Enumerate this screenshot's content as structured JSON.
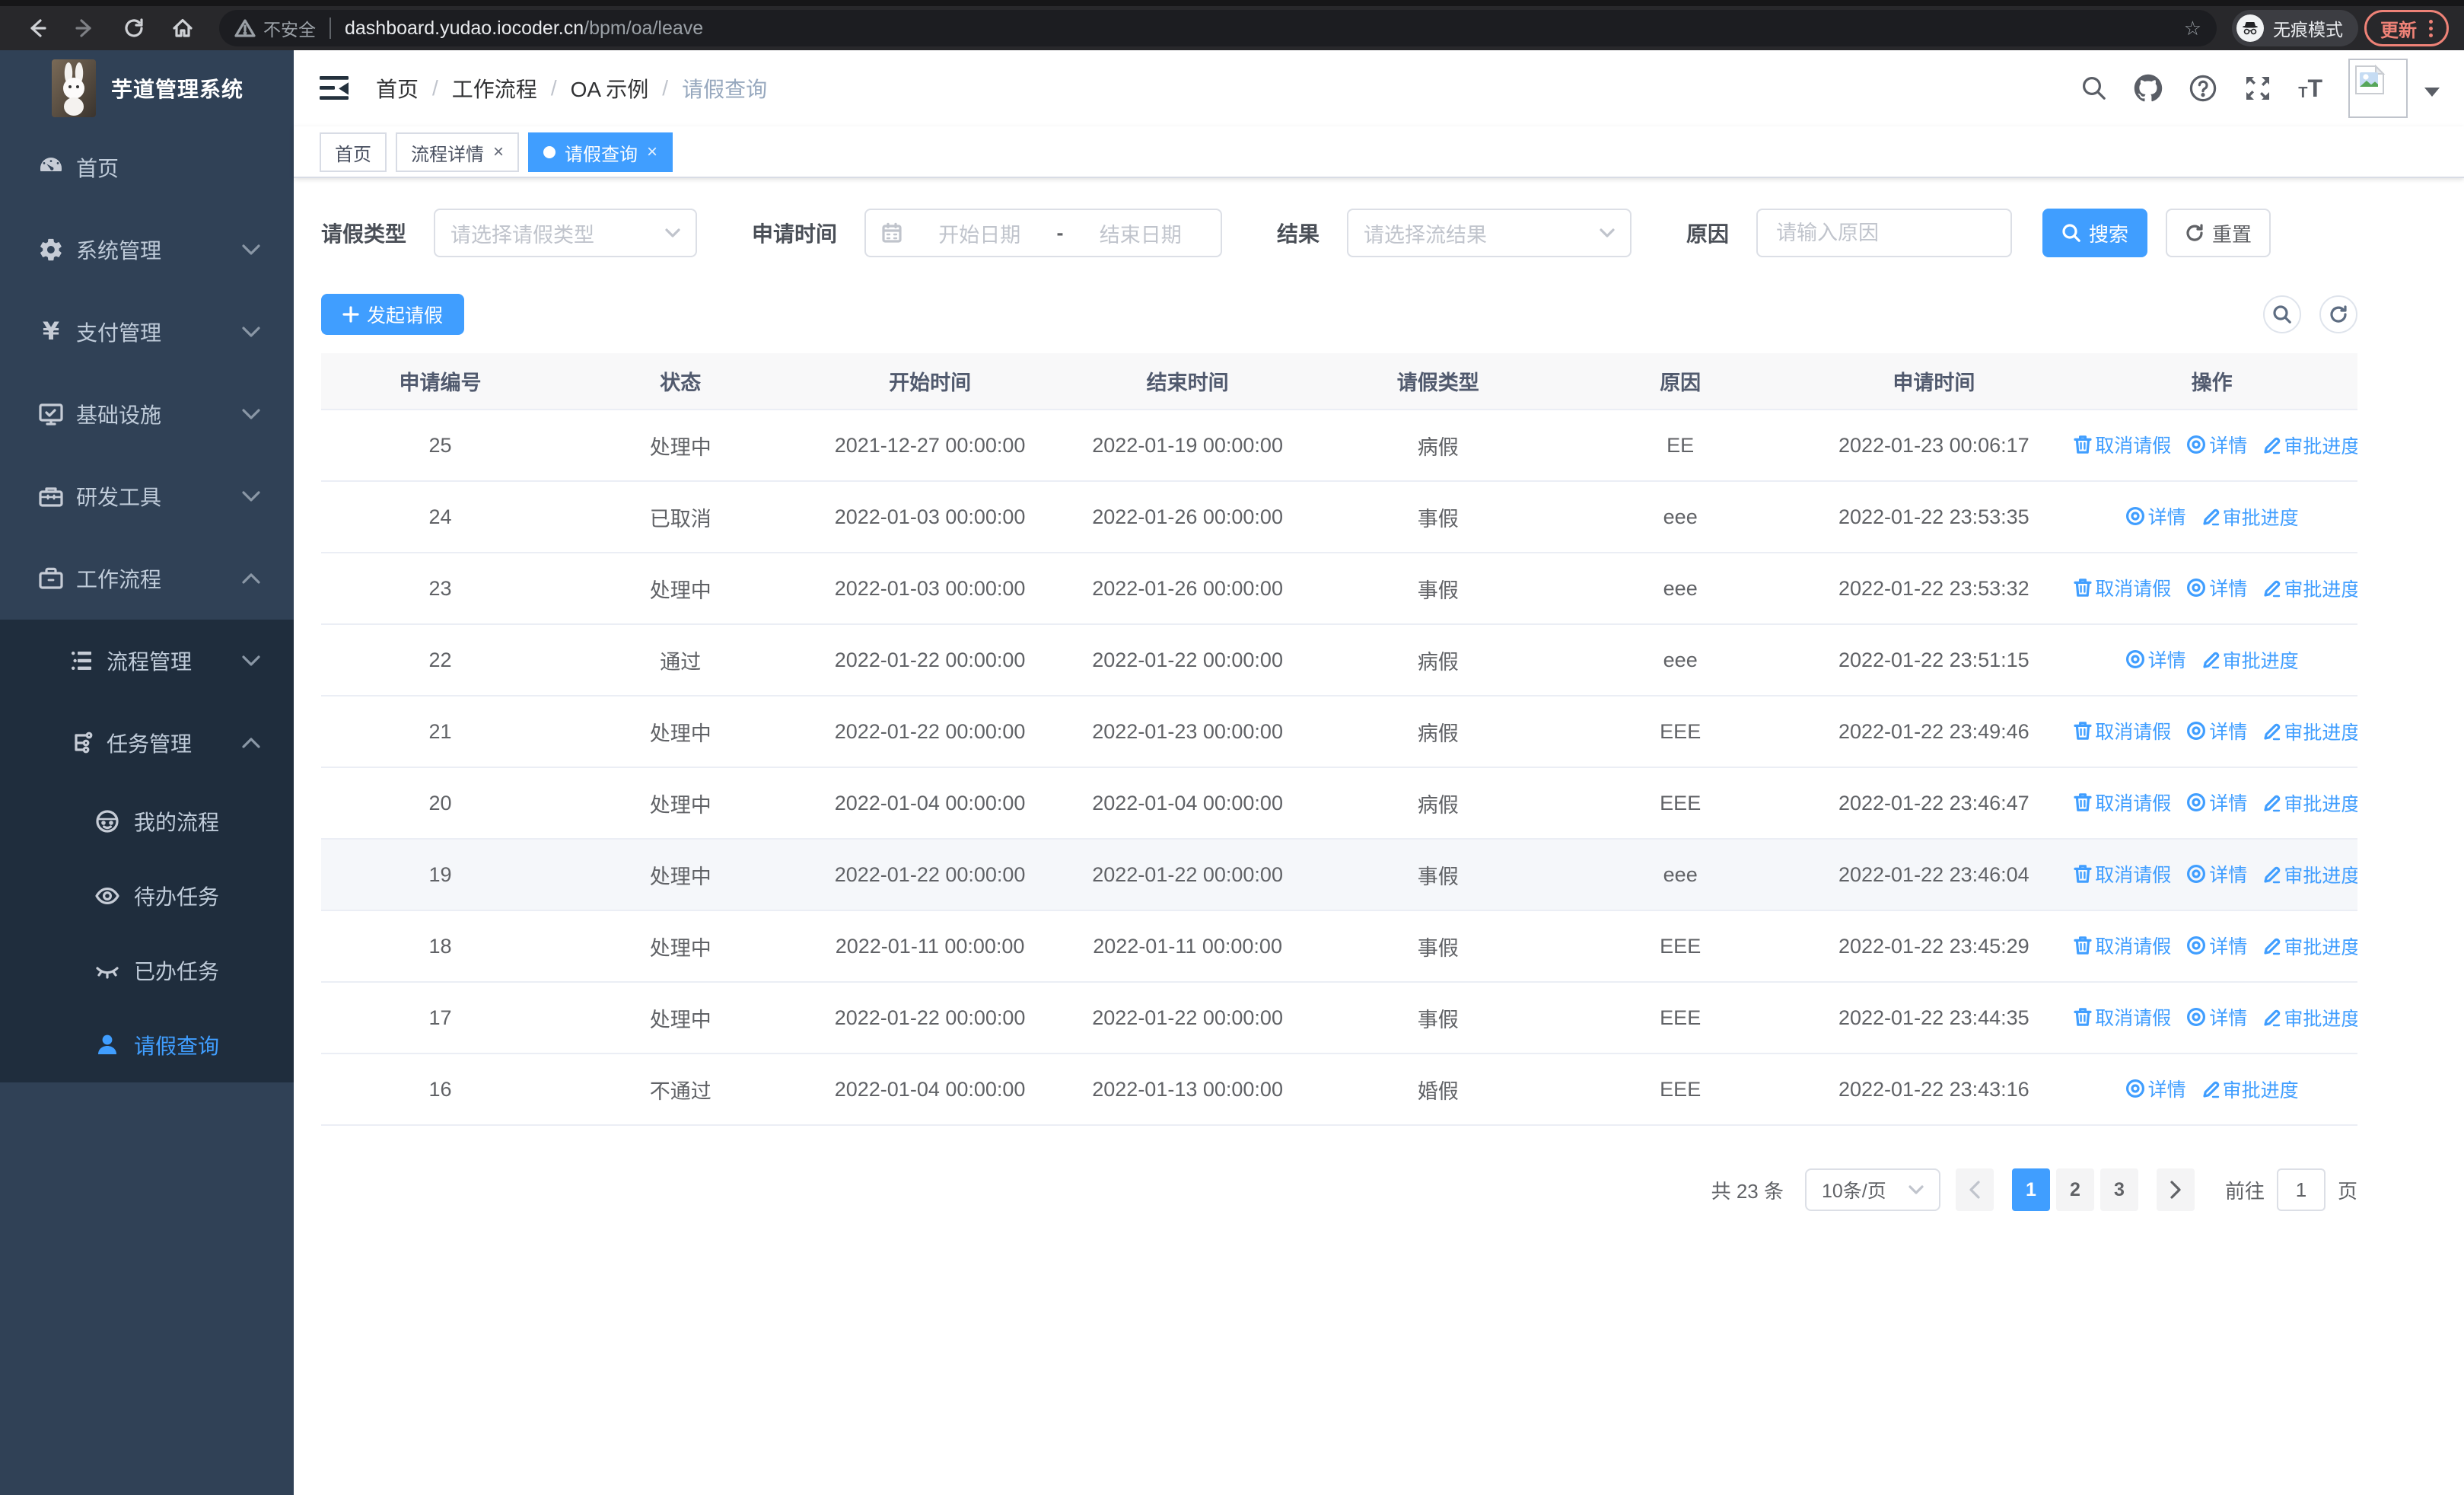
{
  "browser": {
    "security_label": "不安全",
    "url_host": "dashboard.yudao.iocoder.cn",
    "url_path": "/bpm/oa/leave",
    "incognito_label": "无痕模式",
    "update_label": "更新"
  },
  "app": {
    "title": "芋道管理系统",
    "breadcrumb": [
      "首页",
      "工作流程",
      "OA 示例",
      "请假查询"
    ],
    "tabs": [
      {
        "key": "home",
        "label": "首页",
        "closable": false,
        "active": false
      },
      {
        "key": "process-detail",
        "label": "流程详情",
        "closable": true,
        "active": false
      },
      {
        "key": "leave-query",
        "label": "请假查询",
        "closable": true,
        "active": true
      }
    ]
  },
  "sidebar": {
    "items": [
      {
        "key": "home",
        "label": "首页",
        "icon": "dashboard-icon",
        "level": 1
      },
      {
        "key": "system",
        "label": "系统管理",
        "icon": "gear-icon",
        "level": 1,
        "expanded": false
      },
      {
        "key": "payment",
        "label": "支付管理",
        "icon": "yen-icon",
        "level": 1,
        "expanded": false
      },
      {
        "key": "infra",
        "label": "基础设施",
        "icon": "monitor-icon",
        "level": 1,
        "expanded": false
      },
      {
        "key": "devtools",
        "label": "研发工具",
        "icon": "toolbox-icon",
        "level": 1,
        "expanded": false
      },
      {
        "key": "workflow",
        "label": "工作流程",
        "icon": "briefcase-icon",
        "level": 1,
        "expanded": true
      },
      {
        "key": "process-mgmt",
        "label": "流程管理",
        "icon": "process-list-icon",
        "level": 2,
        "expanded": false,
        "group": true
      },
      {
        "key": "task-mgmt",
        "label": "任务管理",
        "icon": "task-tree-icon",
        "level": 2,
        "expanded": true,
        "group": true
      },
      {
        "key": "my-processes",
        "label": "我的流程",
        "icon": "face-icon",
        "level": 3,
        "group": true
      },
      {
        "key": "todo-tasks",
        "label": "待办任务",
        "icon": "eye-open-icon",
        "level": 3,
        "group": true
      },
      {
        "key": "done-tasks",
        "label": "已办任务",
        "icon": "eye-closed-icon",
        "level": 3,
        "group": true
      },
      {
        "key": "leave-query",
        "label": "请假查询",
        "icon": "user-icon",
        "level": 3,
        "group": true,
        "active": true
      }
    ]
  },
  "filters": {
    "leave_type_label": "请假类型",
    "leave_type_placeholder": "请选择请假类型",
    "apply_time_label": "申请时间",
    "date_start_placeholder": "开始日期",
    "date_separator": "-",
    "date_end_placeholder": "结束日期",
    "result_label": "结果",
    "result_placeholder": "请选择流结果",
    "reason_label": "原因",
    "reason_placeholder": "请输入原因",
    "search_label": "搜索",
    "reset_label": "重置"
  },
  "toolbar": {
    "create_label": "发起请假"
  },
  "table": {
    "columns": [
      "申请编号",
      "状态",
      "开始时间",
      "结束时间",
      "请假类型",
      "原因",
      "申请时间",
      "操作"
    ],
    "action_labels": {
      "cancel": "取消请假",
      "detail": "详情",
      "progress": "审批进度"
    },
    "rows": [
      {
        "id": "25",
        "status": "处理中",
        "start": "2021-12-27 00:00:00",
        "end": "2022-01-19 00:00:00",
        "type": "病假",
        "reason": "EE",
        "applied": "2022-01-23 00:06:17",
        "actions": [
          "cancel",
          "detail",
          "progress"
        ]
      },
      {
        "id": "24",
        "status": "已取消",
        "start": "2022-01-03 00:00:00",
        "end": "2022-01-26 00:00:00",
        "type": "事假",
        "reason": "eee",
        "applied": "2022-01-22 23:53:35",
        "actions": [
          "detail",
          "progress"
        ]
      },
      {
        "id": "23",
        "status": "处理中",
        "start": "2022-01-03 00:00:00",
        "end": "2022-01-26 00:00:00",
        "type": "事假",
        "reason": "eee",
        "applied": "2022-01-22 23:53:32",
        "actions": [
          "cancel",
          "detail",
          "progress"
        ]
      },
      {
        "id": "22",
        "status": "通过",
        "start": "2022-01-22 00:00:00",
        "end": "2022-01-22 00:00:00",
        "type": "病假",
        "reason": "eee",
        "applied": "2022-01-22 23:51:15",
        "actions": [
          "detail",
          "progress"
        ]
      },
      {
        "id": "21",
        "status": "处理中",
        "start": "2022-01-22 00:00:00",
        "end": "2022-01-23 00:00:00",
        "type": "病假",
        "reason": "EEE",
        "applied": "2022-01-22 23:49:46",
        "actions": [
          "cancel",
          "detail",
          "progress"
        ]
      },
      {
        "id": "20",
        "status": "处理中",
        "start": "2022-01-04 00:00:00",
        "end": "2022-01-04 00:00:00",
        "type": "病假",
        "reason": "EEE",
        "applied": "2022-01-22 23:46:47",
        "actions": [
          "cancel",
          "detail",
          "progress"
        ]
      },
      {
        "id": "19",
        "status": "处理中",
        "start": "2022-01-22 00:00:00",
        "end": "2022-01-22 00:00:00",
        "type": "事假",
        "reason": "eee",
        "applied": "2022-01-22 23:46:04",
        "actions": [
          "cancel",
          "detail",
          "progress"
        ]
      },
      {
        "id": "18",
        "status": "处理中",
        "start": "2022-01-11 00:00:00",
        "end": "2022-01-11 00:00:00",
        "type": "事假",
        "reason": "EEE",
        "applied": "2022-01-22 23:45:29",
        "actions": [
          "cancel",
          "detail",
          "progress"
        ]
      },
      {
        "id": "17",
        "status": "处理中",
        "start": "2022-01-22 00:00:00",
        "end": "2022-01-22 00:00:00",
        "type": "事假",
        "reason": "EEE",
        "applied": "2022-01-22 23:44:35",
        "actions": [
          "cancel",
          "detail",
          "progress"
        ]
      },
      {
        "id": "16",
        "status": "不通过",
        "start": "2022-01-04 00:00:00",
        "end": "2022-01-13 00:00:00",
        "type": "婚假",
        "reason": "EEE",
        "applied": "2022-01-22 23:43:16",
        "actions": [
          "detail",
          "progress"
        ]
      }
    ]
  },
  "pagination": {
    "total_label": "共 23 条",
    "page_size_label": "10条/页",
    "pages": [
      "1",
      "2",
      "3"
    ],
    "active_page": "1",
    "goto_label": "前往",
    "goto_value": "1",
    "page_suffix": "页"
  },
  "colors": {
    "primary": "#409eff",
    "sidebar_bg": "#304156",
    "submenu_bg": "#1f2d3d",
    "highlight_row": "#f5f7fa"
  }
}
